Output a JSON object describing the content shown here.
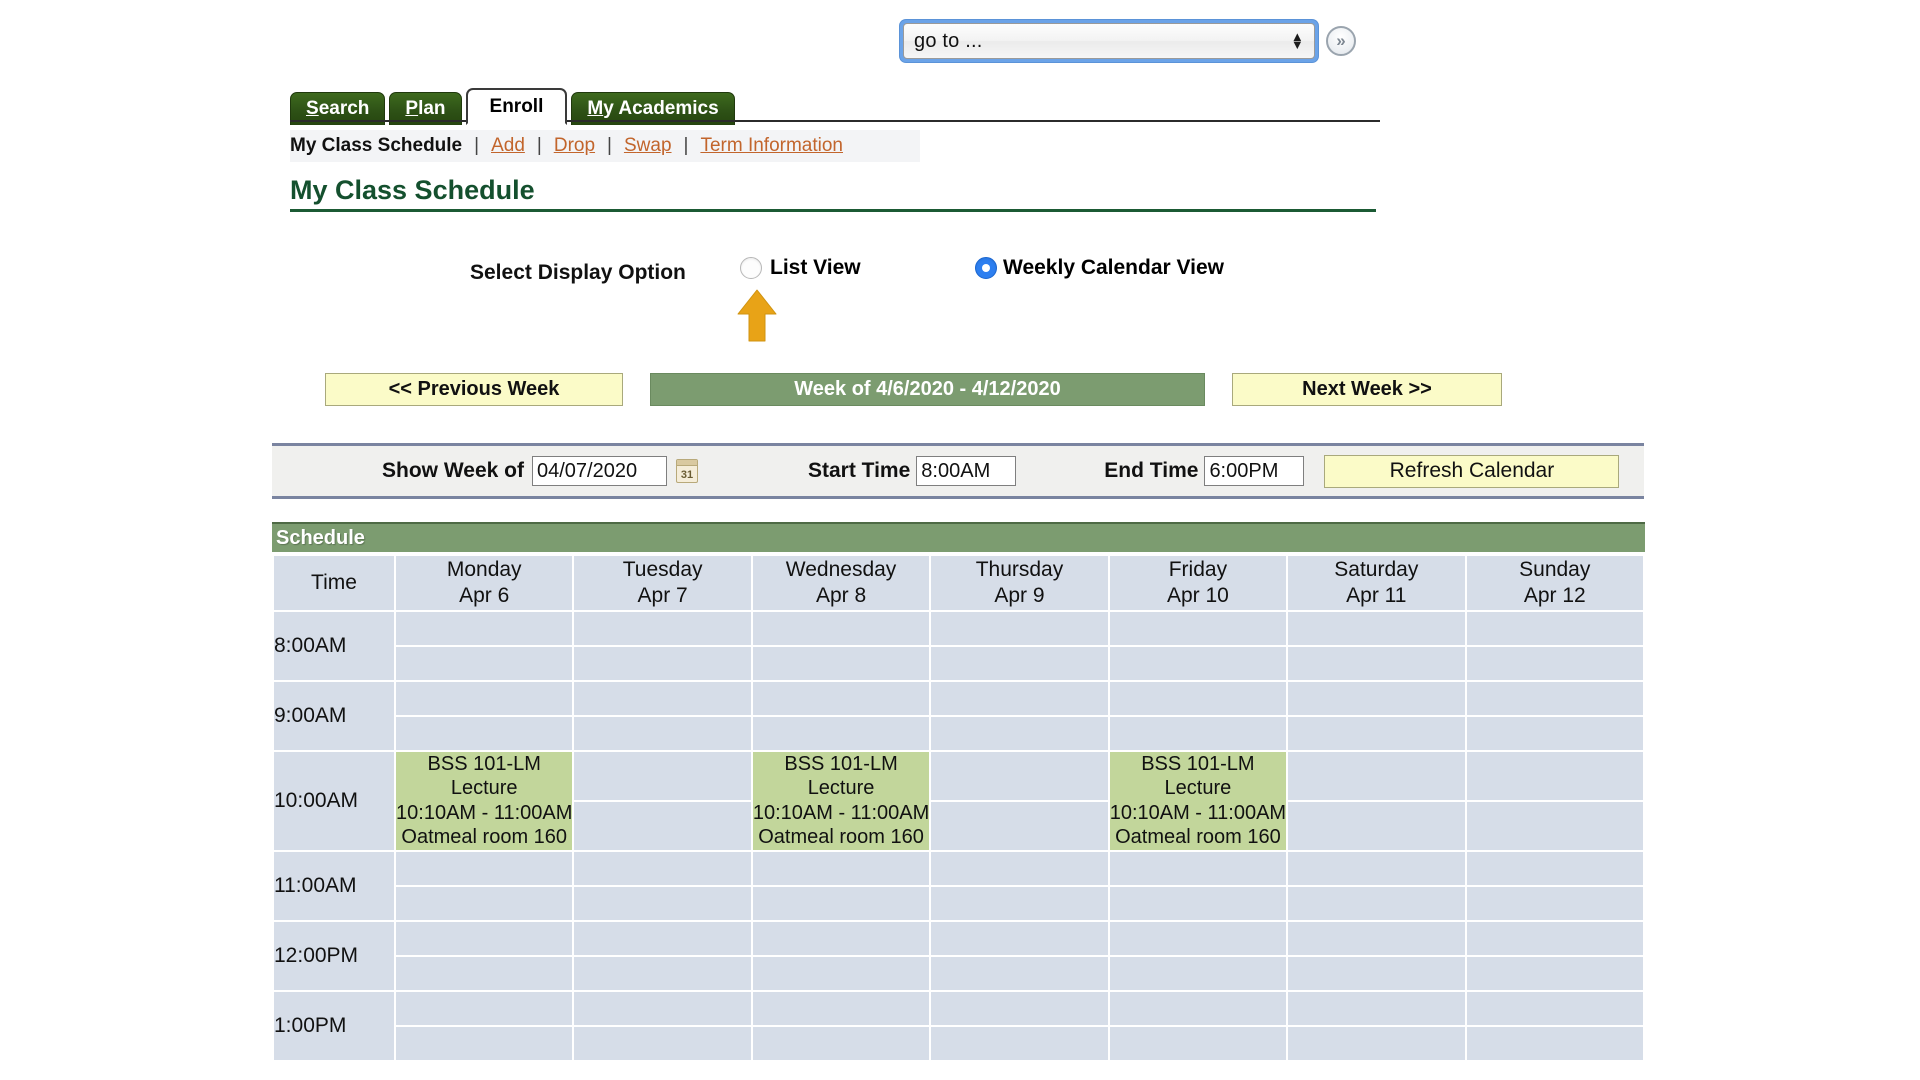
{
  "goto": {
    "value": "go to ...",
    "spinner_icon": "spinner-up-down-icon",
    "submit_icon": "double-chevron-right-icon"
  },
  "tabs": [
    {
      "label": "Search",
      "accesskey": "S",
      "active": false
    },
    {
      "label": "Plan",
      "accesskey": "P",
      "active": false
    },
    {
      "label": "Enroll",
      "accesskey": "",
      "active": true
    },
    {
      "label": "My Academics",
      "accesskey": "M",
      "active": false
    }
  ],
  "subnav": {
    "current": "My Class Schedule",
    "separator": "|",
    "links": [
      {
        "label": "Add",
        "accesskey": "A"
      },
      {
        "label": "Drop",
        "accesskey": "D"
      },
      {
        "label": "Swap",
        "accesskey": "S"
      },
      {
        "label": "Term Information",
        "accesskey": "T"
      }
    ]
  },
  "page_title": "My Class Schedule",
  "display_option": {
    "label": "Select Display Option",
    "options": [
      {
        "label": "List View",
        "selected": false
      },
      {
        "label": "Weekly Calendar View",
        "selected": true
      }
    ],
    "annotation_icon": "orange-up-arrow-annotation"
  },
  "week_nav": {
    "previous": "<< Previous Week",
    "current": "Week of 4/6/2020 - 4/12/2020",
    "next": "Next Week >>"
  },
  "filter_bar": {
    "show_week_label": "Show Week of",
    "show_week_value": "04/07/2020",
    "calendar_icon": "calendar-picker-icon",
    "start_time_label": "Start Time",
    "start_time_value": "8:00AM",
    "end_time_label": "End Time",
    "end_time_value": "6:00PM",
    "refresh_label": "Refresh Calendar"
  },
  "schedule": {
    "section_title": "Schedule",
    "time_column_header": "Time",
    "days": [
      {
        "name": "Monday",
        "date": "Apr 6"
      },
      {
        "name": "Tuesday",
        "date": "Apr 7"
      },
      {
        "name": "Wednesday",
        "date": "Apr 8"
      },
      {
        "name": "Thursday",
        "date": "Apr 9"
      },
      {
        "name": "Friday",
        "date": "Apr 10"
      },
      {
        "name": "Saturday",
        "date": "Apr 11"
      },
      {
        "name": "Sunday",
        "date": "Apr 12"
      }
    ],
    "time_slots": [
      "8:00AM",
      "9:00AM",
      "10:00AM",
      "11:00AM",
      "12:00PM",
      "1:00PM"
    ],
    "events": [
      {
        "day_index": 0,
        "slot_index": 2,
        "course": "BSS 101-LM",
        "component": "Lecture",
        "time": "10:10AM - 11:00AM",
        "location": "Oatmeal room 160",
        "color": "#c2d69b"
      },
      {
        "day_index": 2,
        "slot_index": 2,
        "course": "BSS 101-LM",
        "component": "Lecture",
        "time": "10:10AM - 11:00AM",
        "location": "Oatmeal room 160",
        "color": "#c2d69b"
      },
      {
        "day_index": 4,
        "slot_index": 2,
        "course": "BSS 101-LM",
        "component": "Lecture",
        "time": "10:10AM - 11:00AM",
        "location": "Oatmeal room 160",
        "color": "#c2d69b"
      }
    ]
  },
  "colors": {
    "tab_green": "#2e5216",
    "heading_green": "#14502e",
    "header_band_green": "#7c9c70",
    "button_yellow": "#fbfbc8",
    "cell_blue": "#d6dde8",
    "event_green": "#c2d69b",
    "link_orange": "#c2652c",
    "radio_blue": "#2d7ff0",
    "annotation_orange": "#e8a317"
  }
}
